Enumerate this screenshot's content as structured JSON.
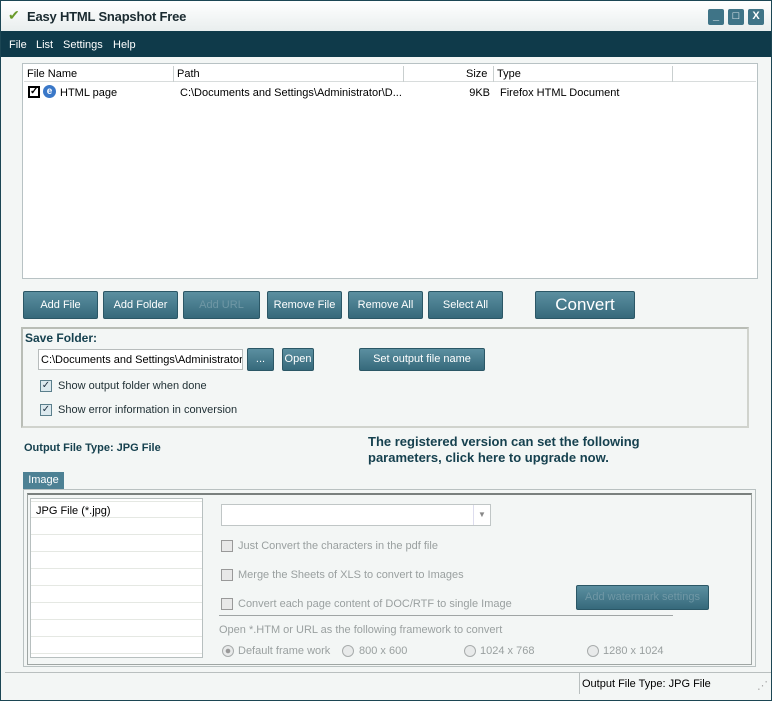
{
  "window": {
    "title": "Easy HTML Snapshot Free",
    "minimize": "_",
    "maximize": "□",
    "close": "X"
  },
  "menu": [
    "File",
    "List",
    "Settings",
    "Help"
  ],
  "filelist": {
    "columns": [
      "File Name",
      "Path",
      "Size",
      "Type"
    ],
    "rows": [
      {
        "checked": true,
        "name": "HTML page",
        "path": "C:\\Documents and Settings\\Administrator\\D...",
        "size": "9KB",
        "type": "Firefox HTML Document"
      }
    ]
  },
  "toolbar": {
    "add_file": "Add File",
    "add_folder": "Add Folder",
    "add_url": "Add URL",
    "remove_file": "Remove File",
    "remove_all": "Remove All",
    "select_all": "Select All",
    "convert": "Convert"
  },
  "save": {
    "label": "Save Folder:",
    "path": "C:\\Documents and Settings\\Administrator",
    "browse": "...",
    "open": "Open",
    "set_name": "Set output file name",
    "show_folder": "Show output folder when done",
    "show_error": "Show error information in conversion"
  },
  "output": {
    "type_label": "Output File Type:  JPG File",
    "upgrade_line1": "The registered version can set the following",
    "upgrade_line2": "parameters, click here to upgrade now."
  },
  "image_tab": {
    "tab": "Image",
    "types": [
      "JPG File  (*.jpg)"
    ],
    "combo_value": "",
    "opt1": "Just Convert the characters in the pdf file",
    "opt2": "Merge the Sheets of XLS to convert to Images",
    "opt3": "Convert each page content of DOC/RTF to single Image",
    "watermark": "Add watermark settings",
    "framework_label": "Open *.HTM or URL as the following framework to convert",
    "radios": [
      "Default frame work",
      "800 x 600",
      "1024 x 768",
      "1280 x 1024"
    ],
    "selected_radio": "Default frame work"
  },
  "status": {
    "output_type": "Output File Type:  JPG File"
  }
}
